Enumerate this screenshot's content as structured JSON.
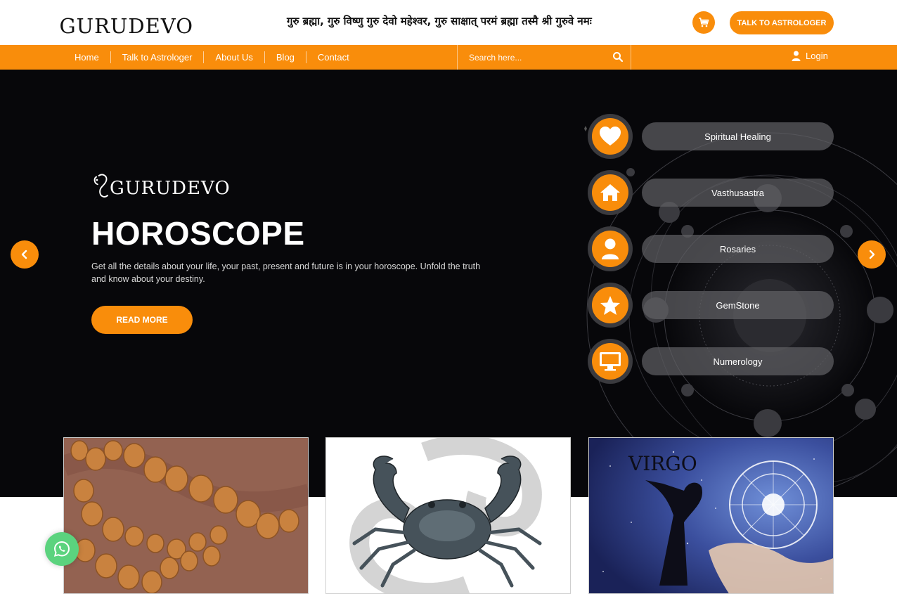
{
  "brand": {
    "name": "GURUDEVO"
  },
  "header": {
    "mantra": "गुरु ब्रह्मा, गुरु विष्णु गुरु देवो महेश्वर, गुरु साक्षात् परमं ब्रह्मा तस्मै श्री गुरुवे नमः",
    "cart_icon": "cart-icon",
    "talk_button": "TALK TO ASTROLOGER"
  },
  "nav": {
    "links": [
      "Home",
      "Talk to Astrologer",
      "About Us",
      "Blog",
      "Contact"
    ],
    "search_placeholder": "Search here...",
    "login": "Login"
  },
  "hero": {
    "logo_text": "GURUDEVO",
    "title": "HOROSCOPE",
    "description": "Get all the details about your life, your past, present and future is in your horoscope. Unfold the truth and know about your destiny.",
    "button": "READ MORE"
  },
  "services": [
    {
      "label": "Spiritual Healing",
      "icon": "heart-icon"
    },
    {
      "label": "Vasthusastra",
      "icon": "home-icon"
    },
    {
      "label": "Rosaries",
      "icon": "user-icon"
    },
    {
      "label": "GemStone",
      "icon": "star-icon"
    },
    {
      "label": "Numerology",
      "icon": "monitor-icon"
    }
  ],
  "cards": [
    {
      "caption": "",
      "image": "rudraksha-beads"
    },
    {
      "caption": "",
      "image": "cancer-crab"
    },
    {
      "caption": "VIRGO",
      "image": "virgo-zodiac"
    }
  ],
  "colors": {
    "accent": "#f98d0b",
    "hero_bg": "#07070a",
    "pill": "#5f5f64",
    "whatsapp": "#5bd37e"
  }
}
